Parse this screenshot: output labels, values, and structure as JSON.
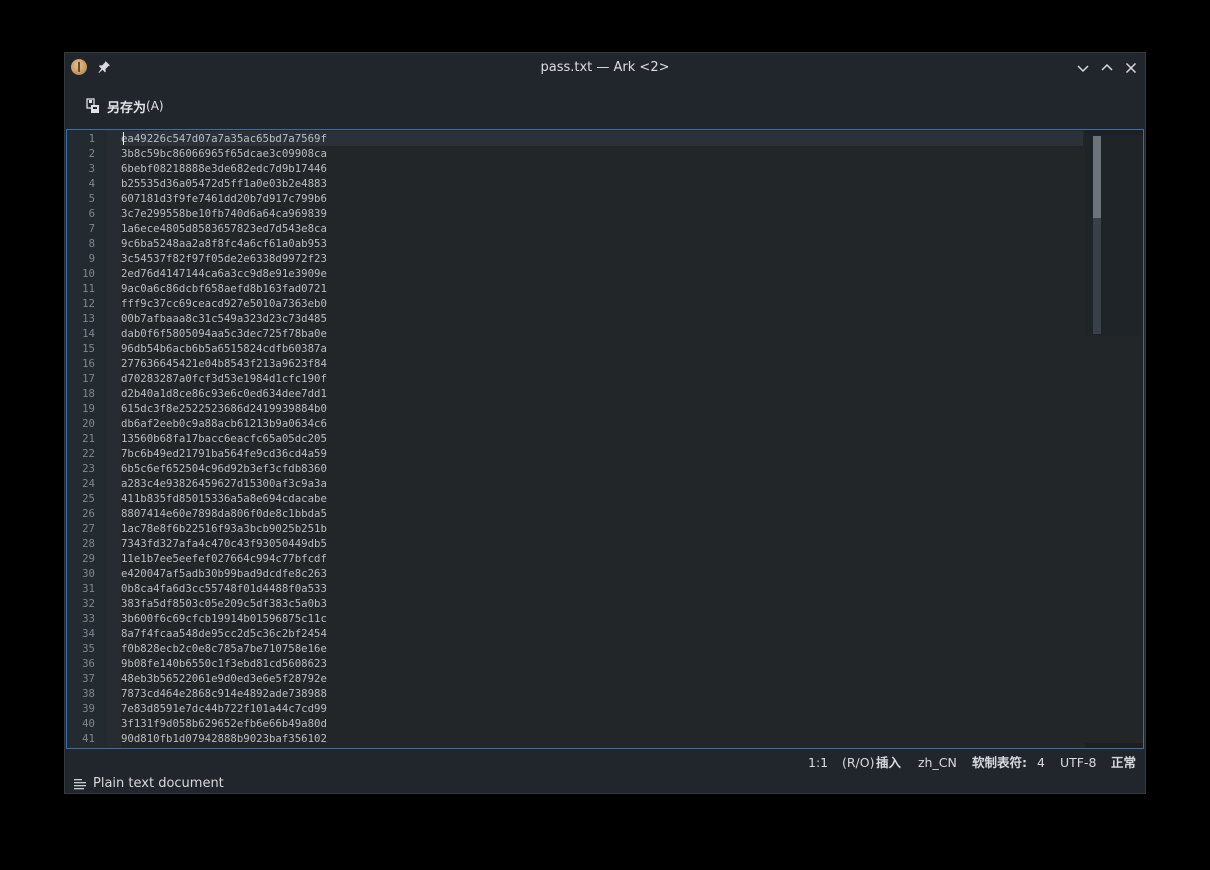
{
  "window": {
    "title": "pass.txt — Ark <2>",
    "icons": [
      "ark-app-icon",
      "pin-icon",
      "minimize-icon",
      "maximize-icon",
      "close-icon"
    ]
  },
  "toolbar": {
    "save_as_label": "另存为",
    "save_as_accel": "(A)",
    "save_as_icon": "save-as-icon"
  },
  "editor": {
    "lines": [
      "ea49226c547d07a7a35ac65bd7a7569f",
      "3b8c59bc86066965f65dcae3c09908ca",
      "6bebf08218888e3de682edc7d9b17446",
      "b25535d36a05472d5ff1a0e03b2e4883",
      "607181d3f9fe7461dd20b7d917c799b6",
      "3c7e299558be10fb740d6a64ca969839",
      "1a6ece4805d8583657823ed7d543e8ca",
      "9c6ba5248aa2a8f8fc4a6cf61a0ab953",
      "3c54537f82f97f05de2e6338d9972f23",
      "2ed76d4147144ca6a3cc9d8e91e3909e",
      "9ac0a6c86dcbf658aefd8b163fad0721",
      "fff9c37cc69ceacd927e5010a7363eb0",
      "00b7afbaaa8c31c549a323d23c73d485",
      "dab0f6f5805094aa5c3dec725f78ba0e",
      "96db54b6acb6b5a6515824cdfb60387a",
      "277636645421e04b8543f213a9623f84",
      "d70283287a0fcf3d53e1984d1cfc190f",
      "d2b40a1d8ce86c93e6c0ed634dee7dd1",
      "615dc3f8e2522523686d2419939884b0",
      "db6af2eeb0c9a88acb61213b9a0634c6",
      "13560b68fa17bacc6eacfc65a05dc205",
      "7bc6b49ed21791ba564fe9cd36cd4a59",
      "6b5c6ef652504c96d92b3ef3cfdb8360",
      "a283c4e93826459627d15300af3c9a3a",
      "411b835fd85015336a5a8e694cdacabe",
      "8807414e60e7898da806f0de8c1bbda5",
      "1ac78e8f6b22516f93a3bcb9025b251b",
      "7343fd327afa4c470c43f93050449db5",
      "11e1b7ee5eefef027664c994c77bfcdf",
      "e420047af5adb30b99bad9dcdfe8c263",
      "0b8ca4fa6d3cc55748f01d4488f0a533",
      "383fa5df8503c05e209c5df383c5a0b3",
      "3b600f6c69cfcb19914b01596875c11c",
      "8a7f4fcaa548de95cc2d5c36c2bf2454",
      "f0b828ecb2c0e8c785a7be710758e16e",
      "9b08fe140b6550c1f3ebd81cd5608623",
      "48eb3b56522061e9d0ed3e6e5f28792e",
      "7873cd464e2868c914e4892ade738988",
      "7e83d8591e7dc44b722f101a44c7cd99",
      "3f131f9d058b629652efb6e66b49a80d",
      "90d810fb1d07942888b9023baf356102"
    ]
  },
  "status": {
    "cursor_pos": "1:1",
    "mode_ro": "(R/O)",
    "mode_insert": "插入",
    "language": "zh_CN",
    "indent_label": "软制表符:",
    "indent_value": "4",
    "encoding": "UTF-8",
    "eol": "正常"
  },
  "document": {
    "type_label": "Plain text document",
    "type_icon": "text-document-icon"
  },
  "colors": {
    "window_bg": "#20262b",
    "editor_bg": "#232629",
    "focus_border": "#3b6fa8",
    "text": "#b9bec4",
    "line_number": "#7f8891"
  }
}
